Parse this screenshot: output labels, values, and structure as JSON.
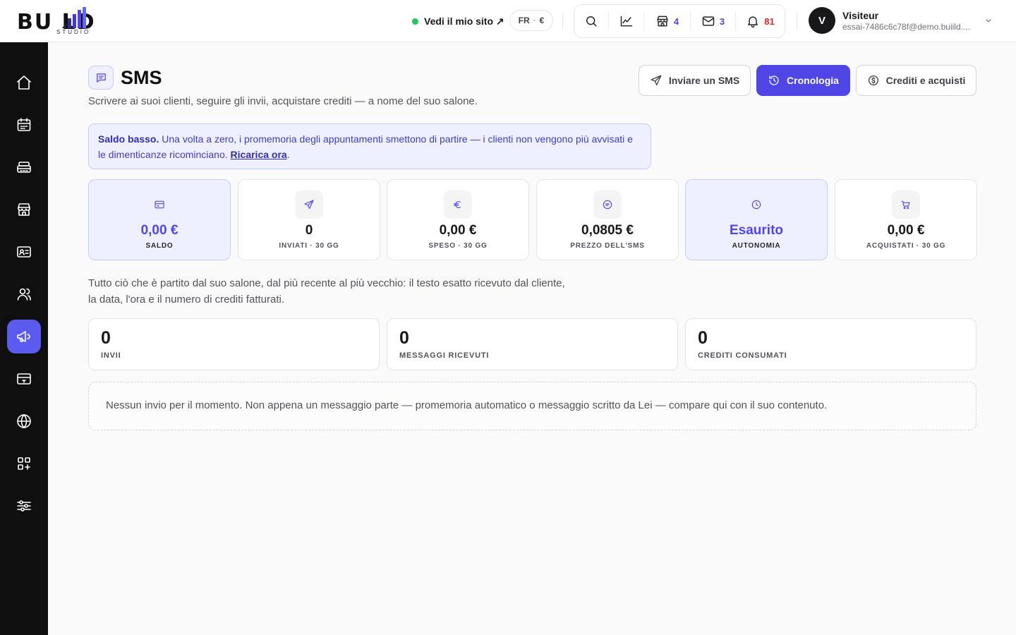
{
  "brand": {
    "logo_main": "BU  LD",
    "logo_sub": "STUDIO"
  },
  "topbar": {
    "visit_site": "Vedi il mio sito ↗",
    "lang": "FR",
    "currency": "€",
    "shop_count": "4",
    "mail_count": "3",
    "notif_count": "81",
    "user": {
      "initial": "V",
      "name": "Visiteur",
      "email": "essai-7486c6c78f@demo.buiild...."
    }
  },
  "page": {
    "title": "SMS",
    "subtitle": "Scrivere ai suoi clienti, seguire gli invii, acquistare crediti — a nome del suo salone."
  },
  "actions": {
    "send": "Inviare un SMS",
    "history": "Cronologia",
    "credits": "Crediti e acquisti"
  },
  "alert": {
    "strong": "Saldo basso.",
    "text": " Una volta a zero, i promemoria degli appuntamenti smettono di partire — i clienti non vengono più avvisati e le dimenticanze ricominciano. ",
    "link": "Ricarica ora",
    "end": "."
  },
  "stats": [
    {
      "value": "0,00 €",
      "label": "SALDO",
      "icon": "card-icon"
    },
    {
      "value": "0",
      "label": "INVIATI · 30 GG",
      "icon": "send-icon"
    },
    {
      "value": "0,00 €",
      "label": "SPESO · 30 GG",
      "icon": "euro-icon"
    },
    {
      "value": "0,0805 €",
      "label": "PREZZO DELL'SMS",
      "icon": "message-icon"
    },
    {
      "value": "Esaurito",
      "label": "AUTONOMIA",
      "icon": "clock-icon"
    },
    {
      "value": "0,00 €",
      "label": "ACQUISTATI · 30 GG",
      "icon": "cart-icon"
    }
  ],
  "history": {
    "intro_1": "Tutto ciò che è partito dal suo salone, dal più recente al più vecchio: il testo esatto ricevuto dal cliente,",
    "intro_2": "la data, l'ora e il numero di crediti fatturati.",
    "summary": [
      {
        "value": "0",
        "label": "INVII"
      },
      {
        "value": "0",
        "label": "MESSAGGI RICEVUTI"
      },
      {
        "value": "0",
        "label": "CREDITI CONSUMATI"
      }
    ],
    "empty": "Nessun invio per il momento. Non appena un messaggio parte — promemoria automatico o messaggio scritto da Lei — compare qui con il suo contenuto."
  },
  "sidebar": {
    "icons": [
      "home-icon",
      "calendar-icon",
      "register-icon",
      "store-icon",
      "contact-card-icon",
      "clients-icon",
      "megaphone-icon",
      "payment-card-icon",
      "globe-icon",
      "apps-icon",
      "settings-sliders-icon"
    ],
    "active": "megaphone-icon"
  },
  "colors": {
    "accent": "#4f46e5",
    "accent_soft": "#eef0ff",
    "sidebar": "#0f0f10",
    "online": "#22c55e",
    "danger": "#dc2626"
  }
}
